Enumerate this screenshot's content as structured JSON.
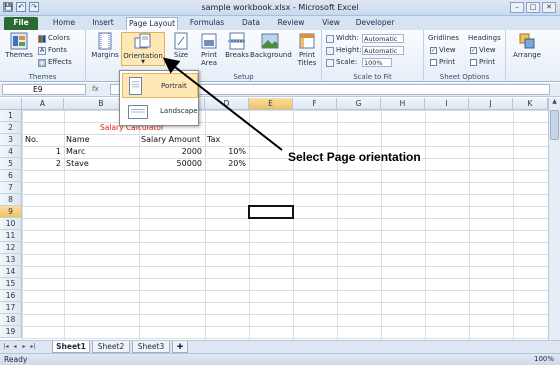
{
  "window": {
    "title": "sample workbook.xlsx - Microsoft Excel",
    "min": "–",
    "max": "□",
    "close": "✕"
  },
  "qat": {
    "save": "💾",
    "undo": "↶",
    "redo": "↷"
  },
  "tabs": [
    "File",
    "Home",
    "Insert",
    "Page Layout",
    "Formulas",
    "Data",
    "Review",
    "View",
    "Developer"
  ],
  "ribbon": {
    "themes": {
      "label": "Themes",
      "group": "Themes",
      "colors": "Colors",
      "fonts": "Fonts",
      "effects": "Effects"
    },
    "page_setup": {
      "group": "Setup",
      "margins": "Margins",
      "orientation": "Orientation",
      "size": "Size",
      "print_area": "Print Area",
      "breaks": "Breaks",
      "background": "Background",
      "print_titles": "Print Titles"
    },
    "scale": {
      "group": "Scale to Fit",
      "width_label": "Width:",
      "width_value": "Automatic",
      "height_label": "Height:",
      "height_value": "Automatic",
      "scale_label": "Scale:",
      "scale_value": "100%"
    },
    "sheet_options": {
      "group": "Sheet Options",
      "gridlines": "Gridlines",
      "headings": "Headings",
      "view": "View",
      "print": "Print"
    },
    "arrange": {
      "label": "Arrange"
    }
  },
  "orientation_menu": {
    "portrait": "Portrait",
    "landscape": "Landscape"
  },
  "formula_bar": {
    "name_box": "E9",
    "fx": "fx",
    "value": ""
  },
  "columns": [
    "A",
    "B",
    "C",
    "D",
    "E",
    "F",
    "G",
    "H",
    "I",
    "J",
    "K"
  ],
  "rows": [
    "1",
    "2",
    "3",
    "4",
    "5",
    "6",
    "7",
    "8",
    "9",
    "10",
    "11",
    "12",
    "13",
    "14",
    "15",
    "16",
    "17",
    "18",
    "19"
  ],
  "cells": {
    "title": "Salary Calculator",
    "headers": {
      "no": "No.",
      "name": "Name",
      "salary": "Salary Amount",
      "tax": "Tax"
    },
    "rows": [
      {
        "no": "1",
        "name": "Marc",
        "salary": "2000",
        "tax": "10%"
      },
      {
        "no": "2",
        "name": "Stave",
        "salary": "50000",
        "tax": "20%"
      }
    ]
  },
  "sheets": [
    "Sheet1",
    "Sheet2",
    "Sheet3"
  ],
  "status": {
    "ready": "Ready",
    "zoom": "100%"
  },
  "annotation": "Select Page orientation"
}
